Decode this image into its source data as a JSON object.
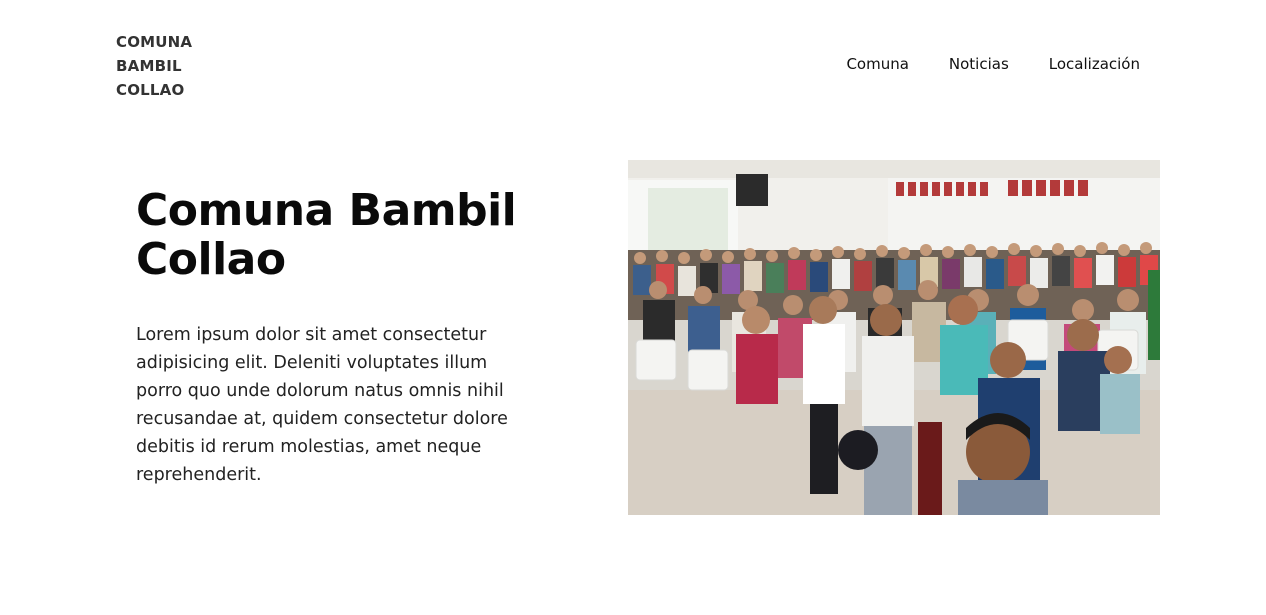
{
  "header": {
    "logo_lines": [
      "COMUNA",
      "BAMBIL",
      "COLLAO"
    ],
    "nav": [
      {
        "label": "Comuna"
      },
      {
        "label": "Noticias"
      },
      {
        "label": "Localización"
      }
    ]
  },
  "hero": {
    "title_lines": [
      "Comuna Bambil",
      "Collao"
    ],
    "body": "Lorem ipsum dolor sit amet consectetur adipisicing elit. Deleniti voluptates illum porro quo unde dolorum natus omnis nihil recusandae at, quidem consectetur dolore debitis id rerum molestias, amet neque reprehenderit.",
    "image_subject": "community-meeting-photo"
  }
}
